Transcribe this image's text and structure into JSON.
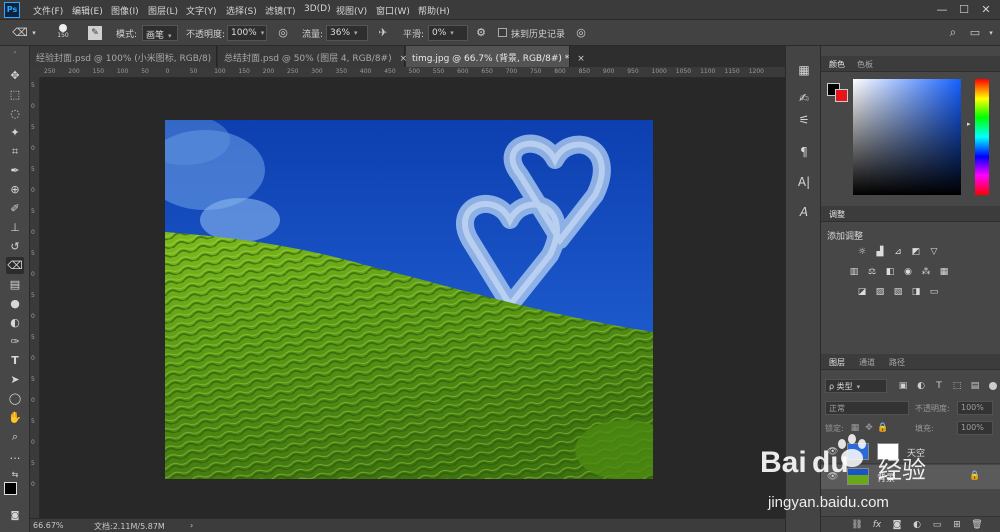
{
  "app": {
    "logo": "Ps"
  },
  "menu": [
    "文件(F)",
    "编辑(E)",
    "图像(I)",
    "图层(L)",
    "文字(Y)",
    "选择(S)",
    "滤镜(T)",
    "3D(D)",
    "视图(V)",
    "窗口(W)",
    "帮助(H)"
  ],
  "window_controls": {
    "minimize": "—",
    "maximize": "☐",
    "close": "✕"
  },
  "options": {
    "brush_size": "150",
    "mode_label": "模式:",
    "mode_value": "画笔",
    "opacity_label": "不透明度:",
    "opacity_value": "100%",
    "flow_label": "流量:",
    "flow_value": "36%",
    "smooth_label": "平滑:",
    "smooth_value": "0%",
    "erase_history_label": "抹到历史记录"
  },
  "tabs": [
    {
      "label": "经验封面.psd @ 100% (小米图标, RGB/8)",
      "close": "×",
      "active": false
    },
    {
      "label": "总结封面.psd @ 50% (图层 4, RGB/8#)",
      "close": "×",
      "active": false
    },
    {
      "label": "timg.jpg @ 66.7% (背景, RGB/8#) *",
      "close": "×",
      "active": true
    }
  ],
  "ruler": {
    "top": [
      "250",
      "200",
      "150",
      "100",
      "50",
      "0",
      "50",
      "100",
      "150",
      "200",
      "250",
      "300",
      "350",
      "400",
      "450",
      "500",
      "550",
      "600",
      "650",
      "700",
      "750",
      "800",
      "850",
      "900",
      "950",
      "1000",
      "1050",
      "1100",
      "1150",
      "1200"
    ],
    "left": [
      "5",
      "0",
      "5",
      "0",
      "5",
      "0",
      "5",
      "0",
      "5",
      "0",
      "5",
      "0",
      "5",
      "0",
      "5",
      "0",
      "5",
      "0",
      "5",
      "0"
    ]
  },
  "status": {
    "zoom": "66.67%",
    "doc": "文档:2.11M/5.87M",
    "arrow": "›"
  },
  "color_panel": {
    "tabs": [
      "颜色",
      "色板"
    ],
    "foreground": "#000000",
    "background": "#e8141c"
  },
  "adjust_panel": {
    "tab": "调整",
    "add_label": "添加调整"
  },
  "layers_panel": {
    "tabs": [
      "图层",
      "通道",
      "路径"
    ],
    "filter_label": "ρ 类型",
    "blend_mode": "正常",
    "opacity_label": "不透明度:",
    "opacity_value": "100%",
    "lock_label": "锁定:",
    "fill_label": "填充:",
    "fill_value": "100%",
    "layers": [
      {
        "name": "天空"
      },
      {
        "name": "背景"
      }
    ]
  },
  "watermark": {
    "brand": "Bai",
    "brand_tail": "经验",
    "du": "du",
    "url": "jingyan.baidu.com"
  },
  "colors": {
    "accent": "#31a8ff",
    "panel": "#474747",
    "chrome": "#3b3b3b",
    "canvas": "#282828"
  }
}
